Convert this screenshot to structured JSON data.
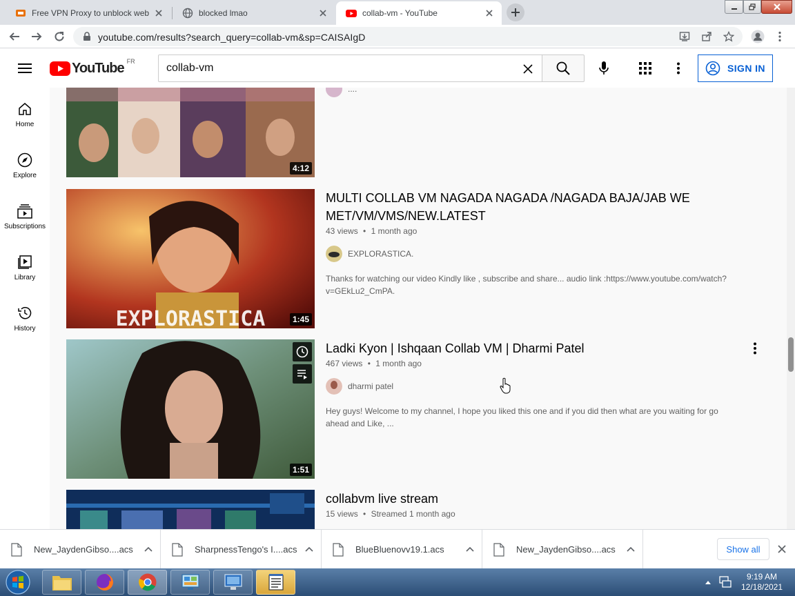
{
  "browser": {
    "tabs": [
      {
        "title": "Free VPN Proxy to unblock websi",
        "active": false
      },
      {
        "title": "blocked lmao",
        "active": false
      },
      {
        "title": "collab-vm - YouTube",
        "active": true
      }
    ],
    "url": "youtube.com/results?search_query=collab-vm&sp=CAISAIgD"
  },
  "youtube": {
    "logo_text": "YouTube",
    "region": "FR",
    "search_value": "collab-vm",
    "sign_in": "SIGN IN"
  },
  "guide": {
    "items": [
      {
        "label": "Home",
        "icon": "home-icon"
      },
      {
        "label": "Explore",
        "icon": "compass-icon"
      },
      {
        "label": "Subscriptions",
        "icon": "subscriptions-icon"
      },
      {
        "label": "Library",
        "icon": "library-icon"
      },
      {
        "label": "History",
        "icon": "history-icon"
      }
    ]
  },
  "results": [
    {
      "duration": "4:12",
      "channel_partial": "...."
    },
    {
      "title": "MULTI COLLAB VM NAGADA NAGADA /NAGADA BAJA/JAB WE MET/VM/VMS/NEW.LATEST",
      "views": "43 views",
      "age": "1 month ago",
      "channel": "EXPLORASTICA.",
      "description": "Thanks for watching our video Kindly like , subscribe and share... audio link :https://www.youtube.com/watch?v=GEkLu2_CmPA.",
      "duration": "1:45",
      "thumb_text": "EXPLORASTICA"
    },
    {
      "title": "Ladki Kyon | Ishqaan Collab VM | Dharmi Patel",
      "views": "467 views",
      "age": "1 month ago",
      "channel": "dharmi patel",
      "description": "Hey guys! Welcome to my channel, I hope you liked this one and if you did then what are you waiting for go ahead and Like, ...",
      "duration": "1:51"
    },
    {
      "title": "collabvm live stream",
      "views": "15 views",
      "age": "Streamed 1 month ago"
    }
  ],
  "separator": "•",
  "downloads": {
    "items": [
      {
        "name": "New_JaydenGibso....acs"
      },
      {
        "name": "SharpnessTengo's I....acs"
      },
      {
        "name": "BlueBluenovv19.1.acs"
      },
      {
        "name": "New_JaydenGibso....acs"
      }
    ],
    "show_all": "Show all"
  },
  "taskbar": {
    "time": "9:19 AM",
    "date": "12/18/2021"
  },
  "colors": {
    "youtube_red": "#ff0000",
    "link_blue": "#065fd4",
    "chrome_tab_bg": "#dee1e6"
  }
}
